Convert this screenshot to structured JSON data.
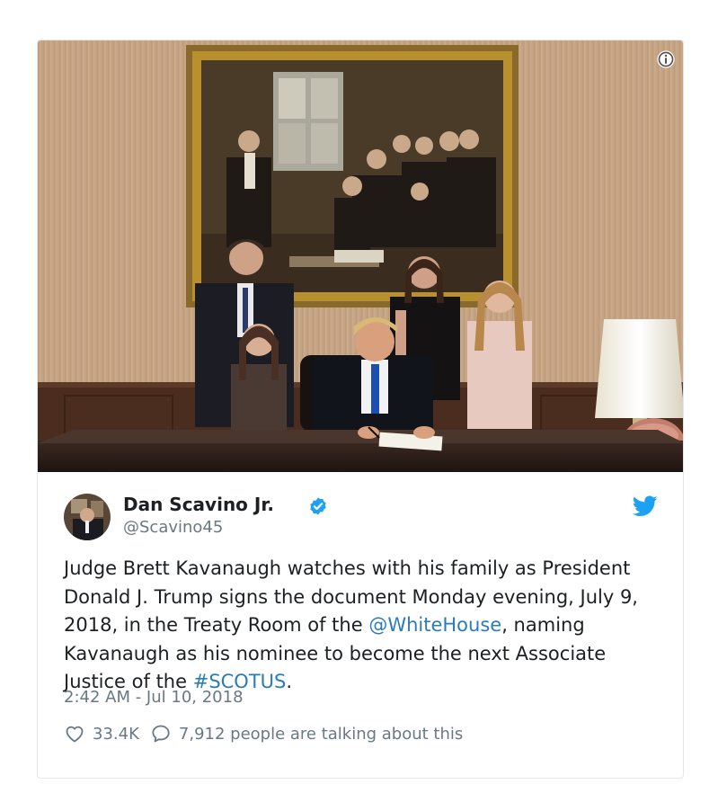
{
  "tweet": {
    "author_name": "Dan Scavino Jr.",
    "author_handle": "@Scavino45",
    "text_parts": [
      "Judge Brett Kavanaugh watches with his family as President Donald J. Trump signs the document Monday evening, July 9, 2018, in the Treaty Room of the ",
      "@WhiteHouse",
      ", naming Kavanaugh as his nominee to become the next Associate Justice of the ",
      "#SCOTUS",
      "."
    ],
    "timestamp": "2:42 AM - Jul 10, 2018",
    "likes": "33.4K",
    "talking": "7,912 people are talking about this"
  },
  "icons": {
    "info": "info-icon",
    "verified": "verified-badge-icon",
    "brand": "twitter-bird-icon",
    "like": "heart-icon",
    "reply": "speech-bubble-icon"
  },
  "colors": {
    "link": "#2b7bb9",
    "verified": "#1da1f2",
    "secondary_text": "#697882",
    "border": "#e1e8ed"
  }
}
